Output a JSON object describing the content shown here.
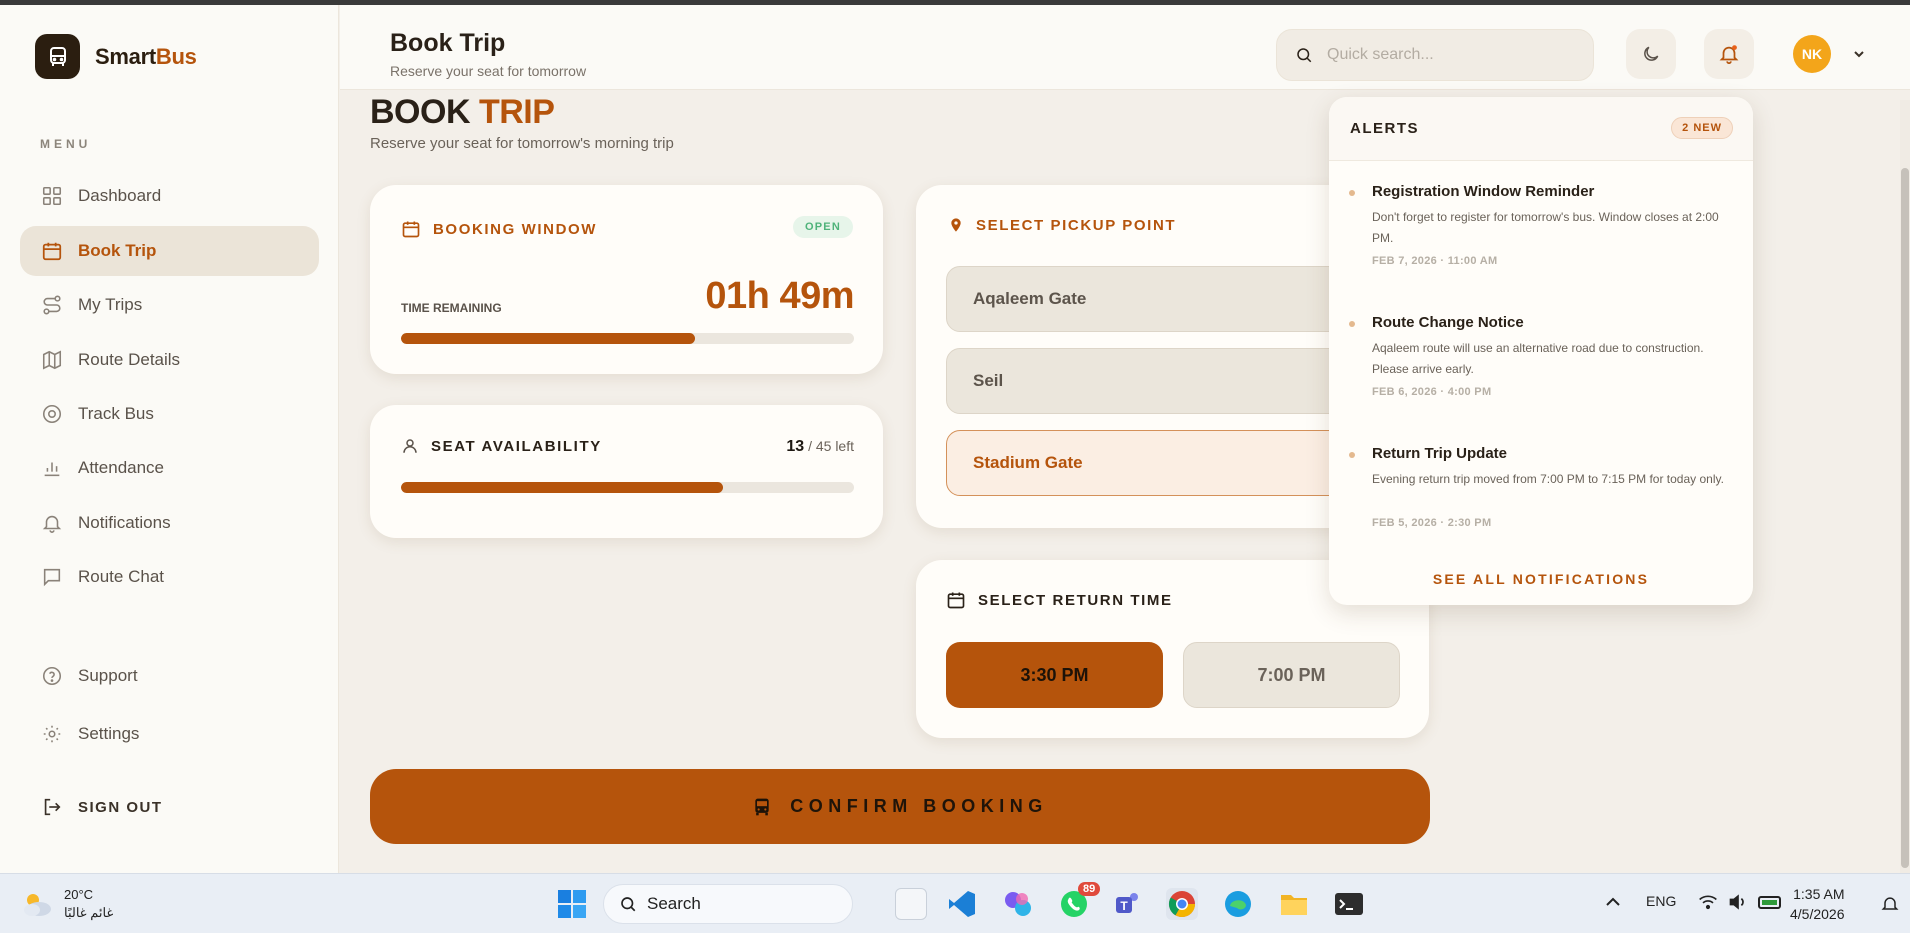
{
  "app": {
    "name_part1": "Smart",
    "name_part2": "Bus"
  },
  "sidebar": {
    "menu_label": "MENU",
    "items": [
      {
        "label": "Dashboard",
        "icon": "grid-icon"
      },
      {
        "label": "Book Trip",
        "icon": "calendar-icon",
        "active": true
      },
      {
        "label": "My Trips",
        "icon": "route-icon"
      },
      {
        "label": "Route Details",
        "icon": "map-icon"
      },
      {
        "label": "Track Bus",
        "icon": "target-icon"
      },
      {
        "label": "Attendance",
        "icon": "bar-chart-icon"
      },
      {
        "label": "Notifications",
        "icon": "bell-icon"
      },
      {
        "label": "Route Chat",
        "icon": "chat-icon"
      }
    ],
    "support_label": "Support",
    "settings_label": "Settings",
    "signout_label": "SIGN OUT"
  },
  "header": {
    "title": "Book Trip",
    "subtitle": "Reserve your seat for tomorrow",
    "search_placeholder": "Quick search...",
    "avatar_initials": "NK"
  },
  "page": {
    "title_part1": "BOOK",
    "title_part2": "TRIP",
    "subtitle": "Reserve your seat for tomorrow's morning trip"
  },
  "booking_window": {
    "title": "BOOKING WINDOW",
    "status": "OPEN",
    "time_label": "TIME REMAINING",
    "time_value": "01h 49m",
    "progress_fraction": 0.65
  },
  "seats": {
    "title": "SEAT AVAILABILITY",
    "available": "13",
    "total_text": "/ 45 left",
    "progress_fraction": 0.71
  },
  "pickup": {
    "title": "SELECT PICKUP POINT",
    "options": [
      "Aqaleem Gate",
      "Seil",
      "Stadium Gate"
    ],
    "selected": "Stadium Gate"
  },
  "return_time": {
    "title": "SELECT RETURN TIME",
    "options": [
      "3:30 PM",
      "7:00 PM"
    ],
    "selected": "3:30 PM"
  },
  "confirm_label": "CONFIRM BOOKING",
  "alerts": {
    "title": "ALERTS",
    "badge": "2 NEW",
    "items": [
      {
        "title": "Registration Window Reminder",
        "message": "Don't forget to register for tomorrow's bus. Window closes at 2:00 PM.",
        "date": "FEB 7, 2026 · 11:00 AM"
      },
      {
        "title": "Route Change Notice",
        "message": "Aqaleem route will use an alternative road due to construction. Please arrive early.",
        "date": "FEB 6, 2026 · 4:00 PM"
      },
      {
        "title": "Return Trip Update",
        "message": "Evening return trip moved from 7:00 PM to 7:15 PM for today only.",
        "date": "FEB 5, 2026 · 2:30 PM"
      }
    ],
    "see_all": "SEE ALL NOTIFICATIONS"
  },
  "taskbar": {
    "temperature": "20°C",
    "weather_text": "غائم غالبًا",
    "search_label": "Search",
    "whatsapp_badge": "89",
    "language": "ENG",
    "time": "1:35 AM",
    "date": "4/5/2026"
  },
  "colors": {
    "accent": "#b5540c",
    "dark": "#2b1e10",
    "background": "#f3efe9"
  }
}
